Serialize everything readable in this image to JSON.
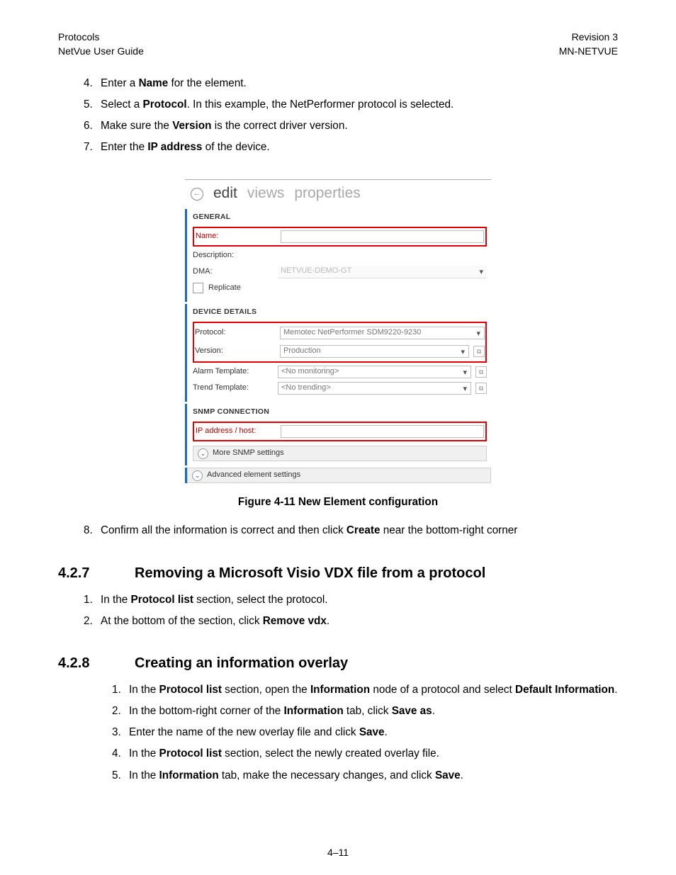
{
  "header": {
    "left_top": "Protocols",
    "left_bottom": "NetVue User Guide",
    "right_top": "Revision 3",
    "right_bottom": "MN-NETVUE"
  },
  "steps_top": {
    "s4": {
      "num": "4.",
      "pre": "Enter a ",
      "b": "Name",
      "post": " for the element."
    },
    "s5": {
      "num": "5.",
      "pre": "Select a ",
      "b": "Protocol",
      "post": ". In this example, the NetPerformer protocol is selected."
    },
    "s6": {
      "num": "6.",
      "pre": "Make sure the ",
      "b": "Version",
      "post": " is the correct driver version."
    },
    "s7": {
      "num": "7.",
      "pre": "Enter the ",
      "b": "IP address",
      "post": " of the device."
    }
  },
  "shot": {
    "tabs": {
      "edit": "edit",
      "views": "views",
      "properties": "properties"
    },
    "general": {
      "title": "GENERAL",
      "name_lbl": "Name:",
      "desc_lbl": "Description:",
      "dma_lbl": "DMA:",
      "dma_val": "NETVUE-DEMO-GT",
      "replicate": "Replicate"
    },
    "device": {
      "title": "DEVICE DETAILS",
      "protocol_lbl": "Protocol:",
      "protocol_val": "Memotec NetPerformer SDM9220-9230",
      "version_lbl": "Version:",
      "version_val": "Production",
      "alarm_lbl": "Alarm Template:",
      "alarm_val": "<No monitoring>",
      "trend_lbl": "Trend Template:",
      "trend_val": "<No trending>"
    },
    "snmp": {
      "title": "SNMP CONNECTION",
      "ip_lbl": "IP address / host:",
      "more": "More SNMP settings"
    },
    "adv": "Advanced element settings"
  },
  "figure_caption": "Figure 4-11 New Element configuration",
  "step8": {
    "num": "8.",
    "pre": "Confirm all the information is correct and then click ",
    "b": "Create",
    "post": " near the bottom-right corner"
  },
  "h427": {
    "num": "4.2.7",
    "title": "Removing a Microsoft Visio VDX file from a protocol"
  },
  "steps_427": {
    "s1": {
      "num": "1.",
      "pre": "In the ",
      "b": "Protocol list",
      "post": " section, select the protocol."
    },
    "s2": {
      "num": "2.",
      "pre": "At the bottom of the section, click ",
      "b": "Remove vdx",
      "post": "."
    }
  },
  "h428": {
    "num": "4.2.8",
    "title": "Creating an information overlay"
  },
  "steps_428": {
    "s1": {
      "num": "1.",
      "a": "In the ",
      "b1": "Protocol list",
      "c": " section, open the ",
      "b2": "Information",
      "d": " node of a protocol and select ",
      "b3": "Default Information",
      "e": "."
    },
    "s2": {
      "num": "2.",
      "a": "In the bottom-right corner of the ",
      "b1": "Information",
      "c": " tab, click ",
      "b2": "Save as",
      "d": "."
    },
    "s3": {
      "num": "3.",
      "a": "Enter the name of the new overlay file and click ",
      "b1": "Save",
      "c": "."
    },
    "s4": {
      "num": "4.",
      "a": "In the ",
      "b1": "Protocol list",
      "c": " section, select the newly created overlay file."
    },
    "s5": {
      "num": "5.",
      "a": "In the ",
      "b1": "Information",
      "c": " tab, make the necessary changes, and click ",
      "b2": "Save",
      "d": "."
    }
  },
  "pagenum": "4–11"
}
